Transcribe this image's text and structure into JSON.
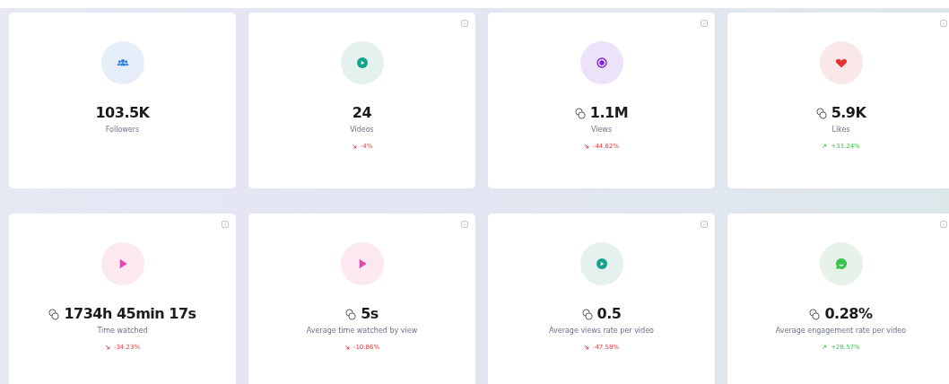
{
  "cards": [
    {
      "kind": "people",
      "value": "103.5K",
      "estimated": false,
      "label": "Followers",
      "info": false
    },
    {
      "kind": "play-circle",
      "value": "24",
      "estimated": false,
      "label": "Videos",
      "info": true,
      "change": "-4%",
      "rising": false
    },
    {
      "kind": "ring",
      "value": "1.1M",
      "estimated": true,
      "label": "Views",
      "info": true,
      "change": "-44.62%",
      "rising": false
    },
    {
      "kind": "heart",
      "value": "5.9K",
      "estimated": true,
      "label": "Likes",
      "info": true,
      "change": "+33.24%",
      "rising": true
    },
    {
      "kind": "play",
      "value": "1734h 45min 17s",
      "estimated": true,
      "label": "Time watched",
      "info": true,
      "change": "-34.23%",
      "rising": false
    },
    {
      "kind": "play",
      "value": "5s",
      "estimated": true,
      "label": "Average time watched by view",
      "info": true,
      "change": "-10.86%",
      "rising": false
    },
    {
      "kind": "play-circle",
      "value": "0.5",
      "estimated": true,
      "label": "Average views rate per video",
      "info": true,
      "change": "-47.58%",
      "rising": false
    },
    {
      "kind": "chat",
      "value": "0.28%",
      "estimated": true,
      "label": "Average engagement rate per video",
      "info": true,
      "change": "+28.57%",
      "rising": true
    }
  ]
}
